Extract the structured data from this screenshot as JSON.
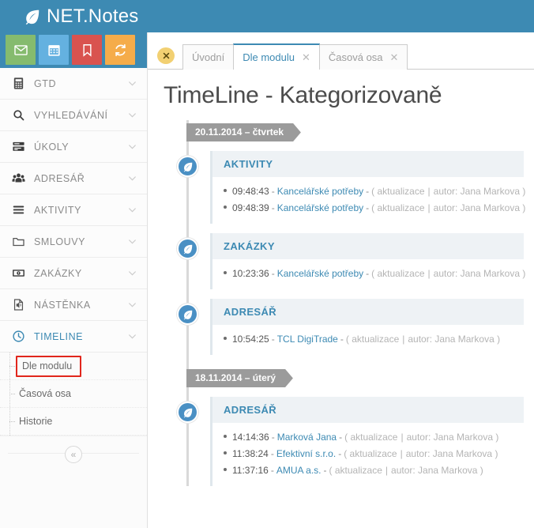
{
  "app": {
    "brand": "NET.Notes",
    "brand_icon": "leaf-icon",
    "header_color": "#3d8ab3",
    "accent_color": "#3d8ab3"
  },
  "quickbar": {
    "buttons": [
      {
        "name": "mail-button",
        "icon": "envelope-icon",
        "color": "#85bb6e"
      },
      {
        "name": "calendar-button",
        "icon": "calendar-icon",
        "color": "#64b1e0"
      },
      {
        "name": "bookmark-button",
        "icon": "bookmark-icon",
        "color": "#d9534f"
      },
      {
        "name": "sync-button",
        "icon": "refresh-icon",
        "color": "#f5ac4a"
      }
    ]
  },
  "sidebar": {
    "items": [
      {
        "label": "GTD",
        "icon": "calculator-icon",
        "active": false
      },
      {
        "label": "VYHLEDÁVÁNÍ",
        "icon": "search-icon",
        "active": false
      },
      {
        "label": "ÚKOLY",
        "icon": "tasks-icon",
        "active": false
      },
      {
        "label": "ADRESÁŘ",
        "icon": "users-icon",
        "active": false
      },
      {
        "label": "AKTIVITY",
        "icon": "list-icon",
        "active": false
      },
      {
        "label": "SMLOUVY",
        "icon": "folder-icon",
        "active": false
      },
      {
        "label": "ZAKÁZKY",
        "icon": "money-icon",
        "active": false
      },
      {
        "label": "NÁSTĚNKA",
        "icon": "announce-icon",
        "active": false
      },
      {
        "label": "TIMELINE",
        "icon": "clock-icon",
        "active": true
      }
    ],
    "subitems": [
      {
        "label": "Dle modulu",
        "highlighted": true
      },
      {
        "label": "Časová osa",
        "highlighted": false
      },
      {
        "label": "Historie",
        "highlighted": false
      }
    ],
    "collapse_glyph": "«",
    "highlight_color": "#e1261c"
  },
  "tabs": {
    "close_all_icon": "close-icon",
    "items": [
      {
        "label": "Úvodní",
        "active": false,
        "closable": false
      },
      {
        "label": "Dle modulu",
        "active": true,
        "closable": true,
        "close_glyph": "✕"
      },
      {
        "label": "Časová osa",
        "active": false,
        "closable": true,
        "close_glyph": "✕"
      }
    ]
  },
  "main": {
    "title": "TimeLine - Kategorizovaně",
    "days": [
      {
        "date": "20.11.2014 – čtvrtek",
        "modules": [
          {
            "name": "AKTIVITY",
            "node_icon": "leaf-icon",
            "entries": [
              {
                "time": "09:48:43",
                "link": "Kancelářské potřeby",
                "meta_action": "aktualizace",
                "meta_author": "autor: Jana Markova"
              },
              {
                "time": "09:48:39",
                "link": "Kancelářské potřeby",
                "meta_action": "aktualizace",
                "meta_author": "autor: Jana Markova"
              }
            ]
          },
          {
            "name": "ZAKÁZKY",
            "node_icon": "leaf-icon",
            "entries": [
              {
                "time": "10:23:36",
                "link": "Kancelářské potřeby",
                "meta_action": "aktualizace",
                "meta_author": "autor: Jana Markova"
              }
            ]
          },
          {
            "name": "ADRESÁŘ",
            "node_icon": "leaf-icon",
            "entries": [
              {
                "time": "10:54:25",
                "link": "TCL DigiTrade",
                "meta_action": "aktualizace",
                "meta_author": "autor: Jana Markova"
              }
            ]
          }
        ]
      },
      {
        "date": "18.11.2014 – úterý",
        "modules": [
          {
            "name": "ADRESÁŘ",
            "node_icon": "leaf-icon",
            "entries": [
              {
                "time": "14:14:36",
                "link": "Marková Jana",
                "meta_action": "aktualizace",
                "meta_author": "autor: Jana Markova"
              },
              {
                "time": "11:38:24",
                "link": "Efektivní s.r.o.",
                "meta_action": "aktualizace",
                "meta_author": "autor: Jana Markova"
              },
              {
                "time": "11:37:16",
                "link": "AMUA a.s.",
                "meta_action": "aktualizace",
                "meta_author": "autor: Jana Markova"
              }
            ]
          }
        ]
      }
    ],
    "entry_separator": "-",
    "meta_open": "(",
    "meta_close": ")",
    "meta_pipe": "|"
  }
}
